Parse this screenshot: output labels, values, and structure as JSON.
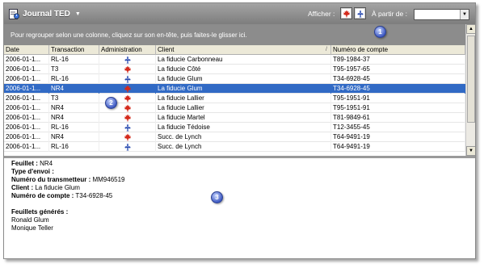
{
  "toolbar": {
    "journal_label": "Journal TED",
    "show_label": "Afficher :",
    "from_label": "À partir de :",
    "date_value": ""
  },
  "group_hint": "Pour regrouper selon une colonne, cliquez sur son en-tête, puis faites-le glisser ici.",
  "grid": {
    "columns": [
      "Date",
      "Transaction",
      "Administration",
      "Client",
      "Numéro de compte"
    ],
    "rows": [
      {
        "date": "2006-01-1...",
        "transaction": "RL-16",
        "admin": "quebec",
        "client": "La fiducie Carbonneau",
        "account": "T89-1984-37"
      },
      {
        "date": "2006-01-1...",
        "transaction": "T3",
        "admin": "canada",
        "client": "La fiducie Côté",
        "account": "T95-1957-65"
      },
      {
        "date": "2006-01-1...",
        "transaction": "RL-16",
        "admin": "quebec",
        "client": "La fiducie Glum",
        "account": "T34-6928-45"
      },
      {
        "date": "2006-01-1...",
        "transaction": "NR4",
        "admin": "canada",
        "client": "La fiducie Glum",
        "account": "T34-6928-45"
      },
      {
        "date": "2006-01-1...",
        "transaction": "T3",
        "admin": "canada",
        "client": "La fiducie Lallier",
        "account": "T95-1951-91"
      },
      {
        "date": "2006-01-1...",
        "transaction": "NR4",
        "admin": "canada",
        "client": "La fiducie Lallier",
        "account": "T95-1951-91"
      },
      {
        "date": "2006-01-1...",
        "transaction": "NR4",
        "admin": "canada",
        "client": "La fiducie Martel",
        "account": "T81-9849-61"
      },
      {
        "date": "2006-01-1...",
        "transaction": "RL-16",
        "admin": "quebec",
        "client": "La fiducie Tédoise",
        "account": "T12-3455-45"
      },
      {
        "date": "2006-01-1...",
        "transaction": "NR4",
        "admin": "canada",
        "client": "Succ. de Lynch",
        "account": "T64-9491-19"
      },
      {
        "date": "2006-01-1...",
        "transaction": "RL-16",
        "admin": "quebec",
        "client": "Succ. de Lynch",
        "account": "T64-9491-19"
      }
    ],
    "selected_index": 3
  },
  "detail": {
    "feuillet_label": "Feuillet :",
    "feuillet_value": "NR4",
    "type_envoi_label": "Type d'envoi :",
    "type_envoi_value": "",
    "transmetteur_label": "Numéro du transmetteur :",
    "transmetteur_value": "MM946519",
    "client_label": "Client :",
    "client_value": "La fiducie Glum",
    "compte_label": "Numéro de compte :",
    "compte_value": "T34-6928-45",
    "generated_label": "Feuillets générés :",
    "generated": [
      "Ronald Glum",
      "Monique Teller"
    ]
  },
  "badges": [
    "1",
    "2",
    "3"
  ],
  "colors": {
    "selection": "#316ac5",
    "toolbar": "#8f8f8f",
    "quebec_flag": "#2a4bb0",
    "canada_flag": "#d42a1c",
    "badge": "#3e59c2"
  },
  "icons": {
    "journal": "journal-icon",
    "quebec": "fleur-de-lis-icon",
    "canada": "maple-leaf-icon"
  }
}
